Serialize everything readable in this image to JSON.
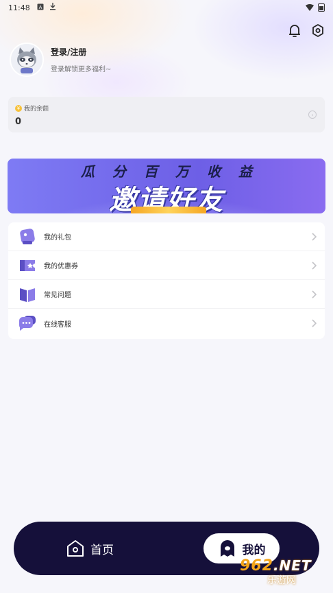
{
  "status_bar": {
    "time": "11:48",
    "icons": [
      "notification-a-icon",
      "download-icon"
    ],
    "right_icons": [
      "wifi-icon",
      "battery-icon"
    ]
  },
  "header": {
    "icons": [
      "bell-icon",
      "settings-icon"
    ]
  },
  "profile": {
    "avatar_icon": "raccoon-avatar-icon",
    "title": "登录/注册",
    "subtitle": "登录解锁更多福利~"
  },
  "balance": {
    "label": "我的余额",
    "value": "0",
    "coin_icon": "coin-icon",
    "arrow_icon": "chevron-circle-right-icon"
  },
  "banner": {
    "line1": "瓜分百万收益",
    "line2": "邀请好友"
  },
  "menu": {
    "items": [
      {
        "label": "我的礼包",
        "icon": "gift-bag-icon"
      },
      {
        "label": "我的优惠券",
        "icon": "coupon-icon"
      },
      {
        "label": "常见问题",
        "icon": "book-icon"
      },
      {
        "label": "在线客服",
        "icon": "chat-icon"
      }
    ]
  },
  "tabbar": {
    "home_label": "首页",
    "mine_label": "我的",
    "active": "mine"
  },
  "watermark": {
    "logo": "962",
    "suffix": ".NET",
    "sub": "乐游网"
  },
  "colors": {
    "accent": "#6d5fe6",
    "icon_purple": "#8b7ce8",
    "tabbar_bg": "#15103a",
    "page_bg": "#f6f6fb"
  }
}
